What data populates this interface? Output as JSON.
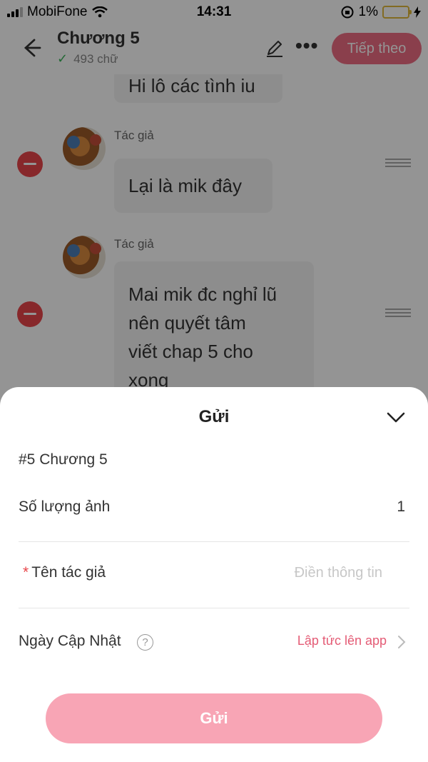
{
  "status_bar": {
    "carrier": "MobiFone",
    "time": "14:31",
    "battery": "1%"
  },
  "header": {
    "title": "Chương 5",
    "word_count": "493 chữ",
    "next_label": "Tiếp theo",
    "accent_color": "#ee6d83"
  },
  "chat": {
    "partial_text": "Hi lô các tình iu",
    "messages": [
      {
        "author": "Tác giả",
        "text": "Lại là mik đây"
      },
      {
        "author": "Tác giả",
        "lines": [
          "Mai mik đc nghỉ lũ",
          "nên quyết tâm",
          "viết chap 5 cho",
          "xong"
        ]
      }
    ]
  },
  "sheet": {
    "title": "Gửi",
    "chapter": "#5 Chương 5",
    "image_count_label": "Số lượng ảnh",
    "image_count_value": "1",
    "author_required_mark": "*",
    "author_label": "Tên tác giả",
    "author_placeholder": "Điền thông tin",
    "update_date_label": "Ngày Cập Nhật",
    "help_icon_glyph": "?",
    "update_date_value": "Lập tức lên app",
    "send_label": "Gửi",
    "send_color": "#f8a5b5"
  }
}
